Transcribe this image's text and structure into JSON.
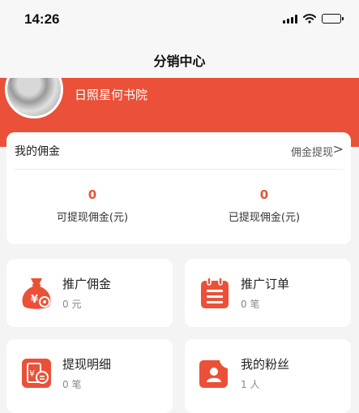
{
  "status_bar": {
    "time": "14:26"
  },
  "nav": {
    "title": "分销中心"
  },
  "profile": {
    "name": "日照星何书院"
  },
  "commission": {
    "title": "我的佣金",
    "link_label": "佣金提现",
    "chevron": ">",
    "withdrawable_value": "0",
    "withdrawable_label": "可提现佣金(元)",
    "withdrawn_value": "0",
    "withdrawn_label": "已提现佣金(元)"
  },
  "tiles": [
    {
      "title": "推广佣金",
      "sub": "0 元",
      "icon": "money-bag-icon"
    },
    {
      "title": "推广订单",
      "sub": "0 笔",
      "icon": "order-list-icon"
    },
    {
      "title": "提现明细",
      "sub": "0 笔",
      "icon": "withdraw-detail-icon"
    },
    {
      "title": "我的粉丝",
      "sub": "1 人",
      "icon": "fans-icon"
    }
  ],
  "colors": {
    "accent": "#ea5138",
    "background": "#f4f4f4",
    "card": "#ffffff"
  }
}
